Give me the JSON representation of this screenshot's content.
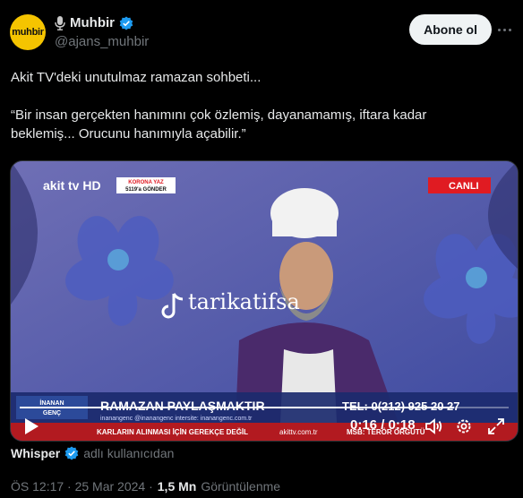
{
  "header": {
    "avatar_text": "muhbir",
    "display_name": "Muhbir",
    "handle": "@ajans_muhbir",
    "follow_label": "Abone ol"
  },
  "tweet": {
    "line1": "Akit TV'deki unutulmaz ramazan sohbeti...",
    "quote_line1": "“Bir insan gerçekten hanımını çok özlemiş, dayanamamış, iftara kadar",
    "quote_line2": "beklemiş... Orucunu hanımıyla açabilir.”"
  },
  "video": {
    "channel_logo": "akit tv HD",
    "corner_badge_lines": [
      "KORONA YAZ",
      "5119'a GÖNDER"
    ],
    "live_badge": "CANLI",
    "watermark": "tarikatifsa",
    "lower_third_name_lines": [
      "İNANAN",
      "GENÇ"
    ],
    "lower_third_title": "RAMAZAN PAYLAŞMAKTIR",
    "lower_third_socials": "inanangenc   @inanangenc   intersite: inanangenc.com.tr",
    "tel_label": "TEL: 0(212) 925 20 27",
    "ticker_left": "KARLARIN ALINMASI İÇİN GEREKÇE DEĞİL",
    "ticker_mid": "akittv.com.tr",
    "ticker_right": "MSB: TERÖR ÖRGÜTÜ",
    "time_label": "0:16 / 0:18",
    "progress_fraction": 0.889,
    "accent_red": "#e01b22"
  },
  "meta": {
    "contributor": "Whisper",
    "contributor_note": "adlı kullanıcıdan"
  },
  "footer": {
    "timestamp": "ÖS 12:17 · 25 Mar 2024 ·",
    "views": "1,5 Mn",
    "views_label": "Görüntülenme"
  },
  "icons": [
    "mic-icon",
    "verified-icon",
    "more-icon",
    "play-icon",
    "volume-icon",
    "settings-icon",
    "fullscreen-icon",
    "tiktok-icon"
  ]
}
